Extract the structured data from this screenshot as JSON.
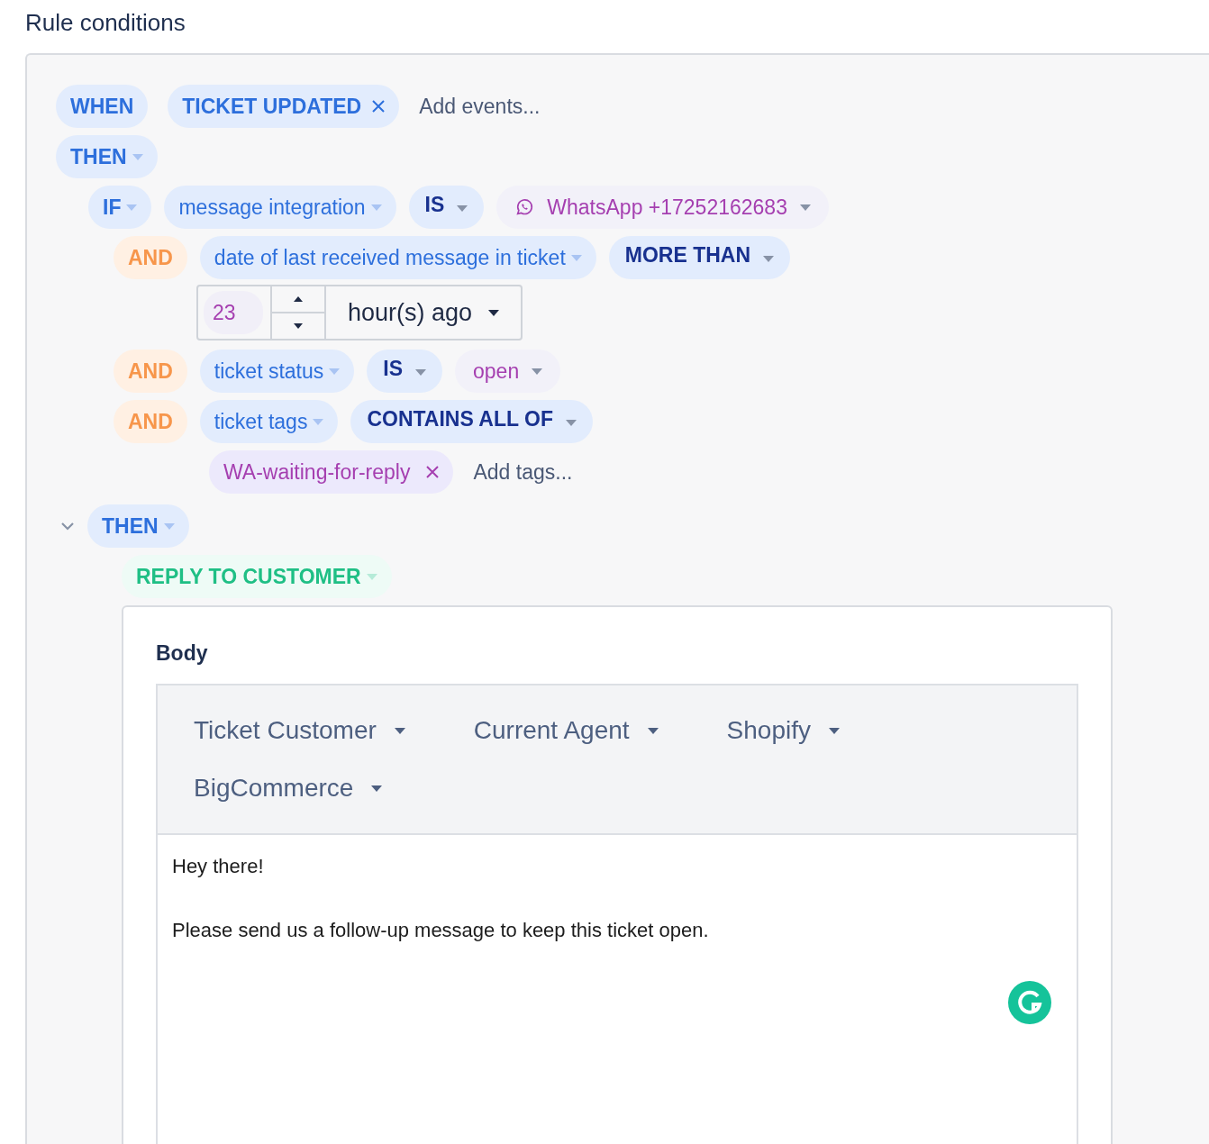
{
  "title": "Rule conditions",
  "when": {
    "label": "WHEN",
    "events": [
      {
        "label": "TICKET UPDATED"
      }
    ],
    "events_placeholder": "Add events..."
  },
  "then": {
    "label": "THEN"
  },
  "if": {
    "label": "IF",
    "field": "message integration",
    "operator": "IS",
    "value": "WhatsApp +17252162683"
  },
  "conditions": [
    {
      "kind": "time",
      "joiner": "AND",
      "field": "date of last received message in ticket",
      "operator": "MORE THAN",
      "amount": "23",
      "unit": "hour(s) ago"
    },
    {
      "kind": "value",
      "joiner": "AND",
      "field": "ticket status",
      "operator": "IS",
      "value": "open"
    },
    {
      "kind": "tags",
      "joiner": "AND",
      "field": "ticket tags",
      "operator": "CONTAINS ALL OF",
      "tags": [
        {
          "label": "WA-waiting-for-reply"
        }
      ],
      "tags_placeholder": "Add tags..."
    }
  ],
  "actions": {
    "label": "THEN",
    "expanded": true,
    "action": "REPLY TO CUSTOMER",
    "body_label": "Body",
    "variable_menus": [
      "Ticket Customer",
      "Current Agent",
      "Shopify",
      "BigCommerce"
    ],
    "paragraphs": [
      "Hey there!",
      "Please send us a follow-up message to keep this ticket open."
    ]
  }
}
